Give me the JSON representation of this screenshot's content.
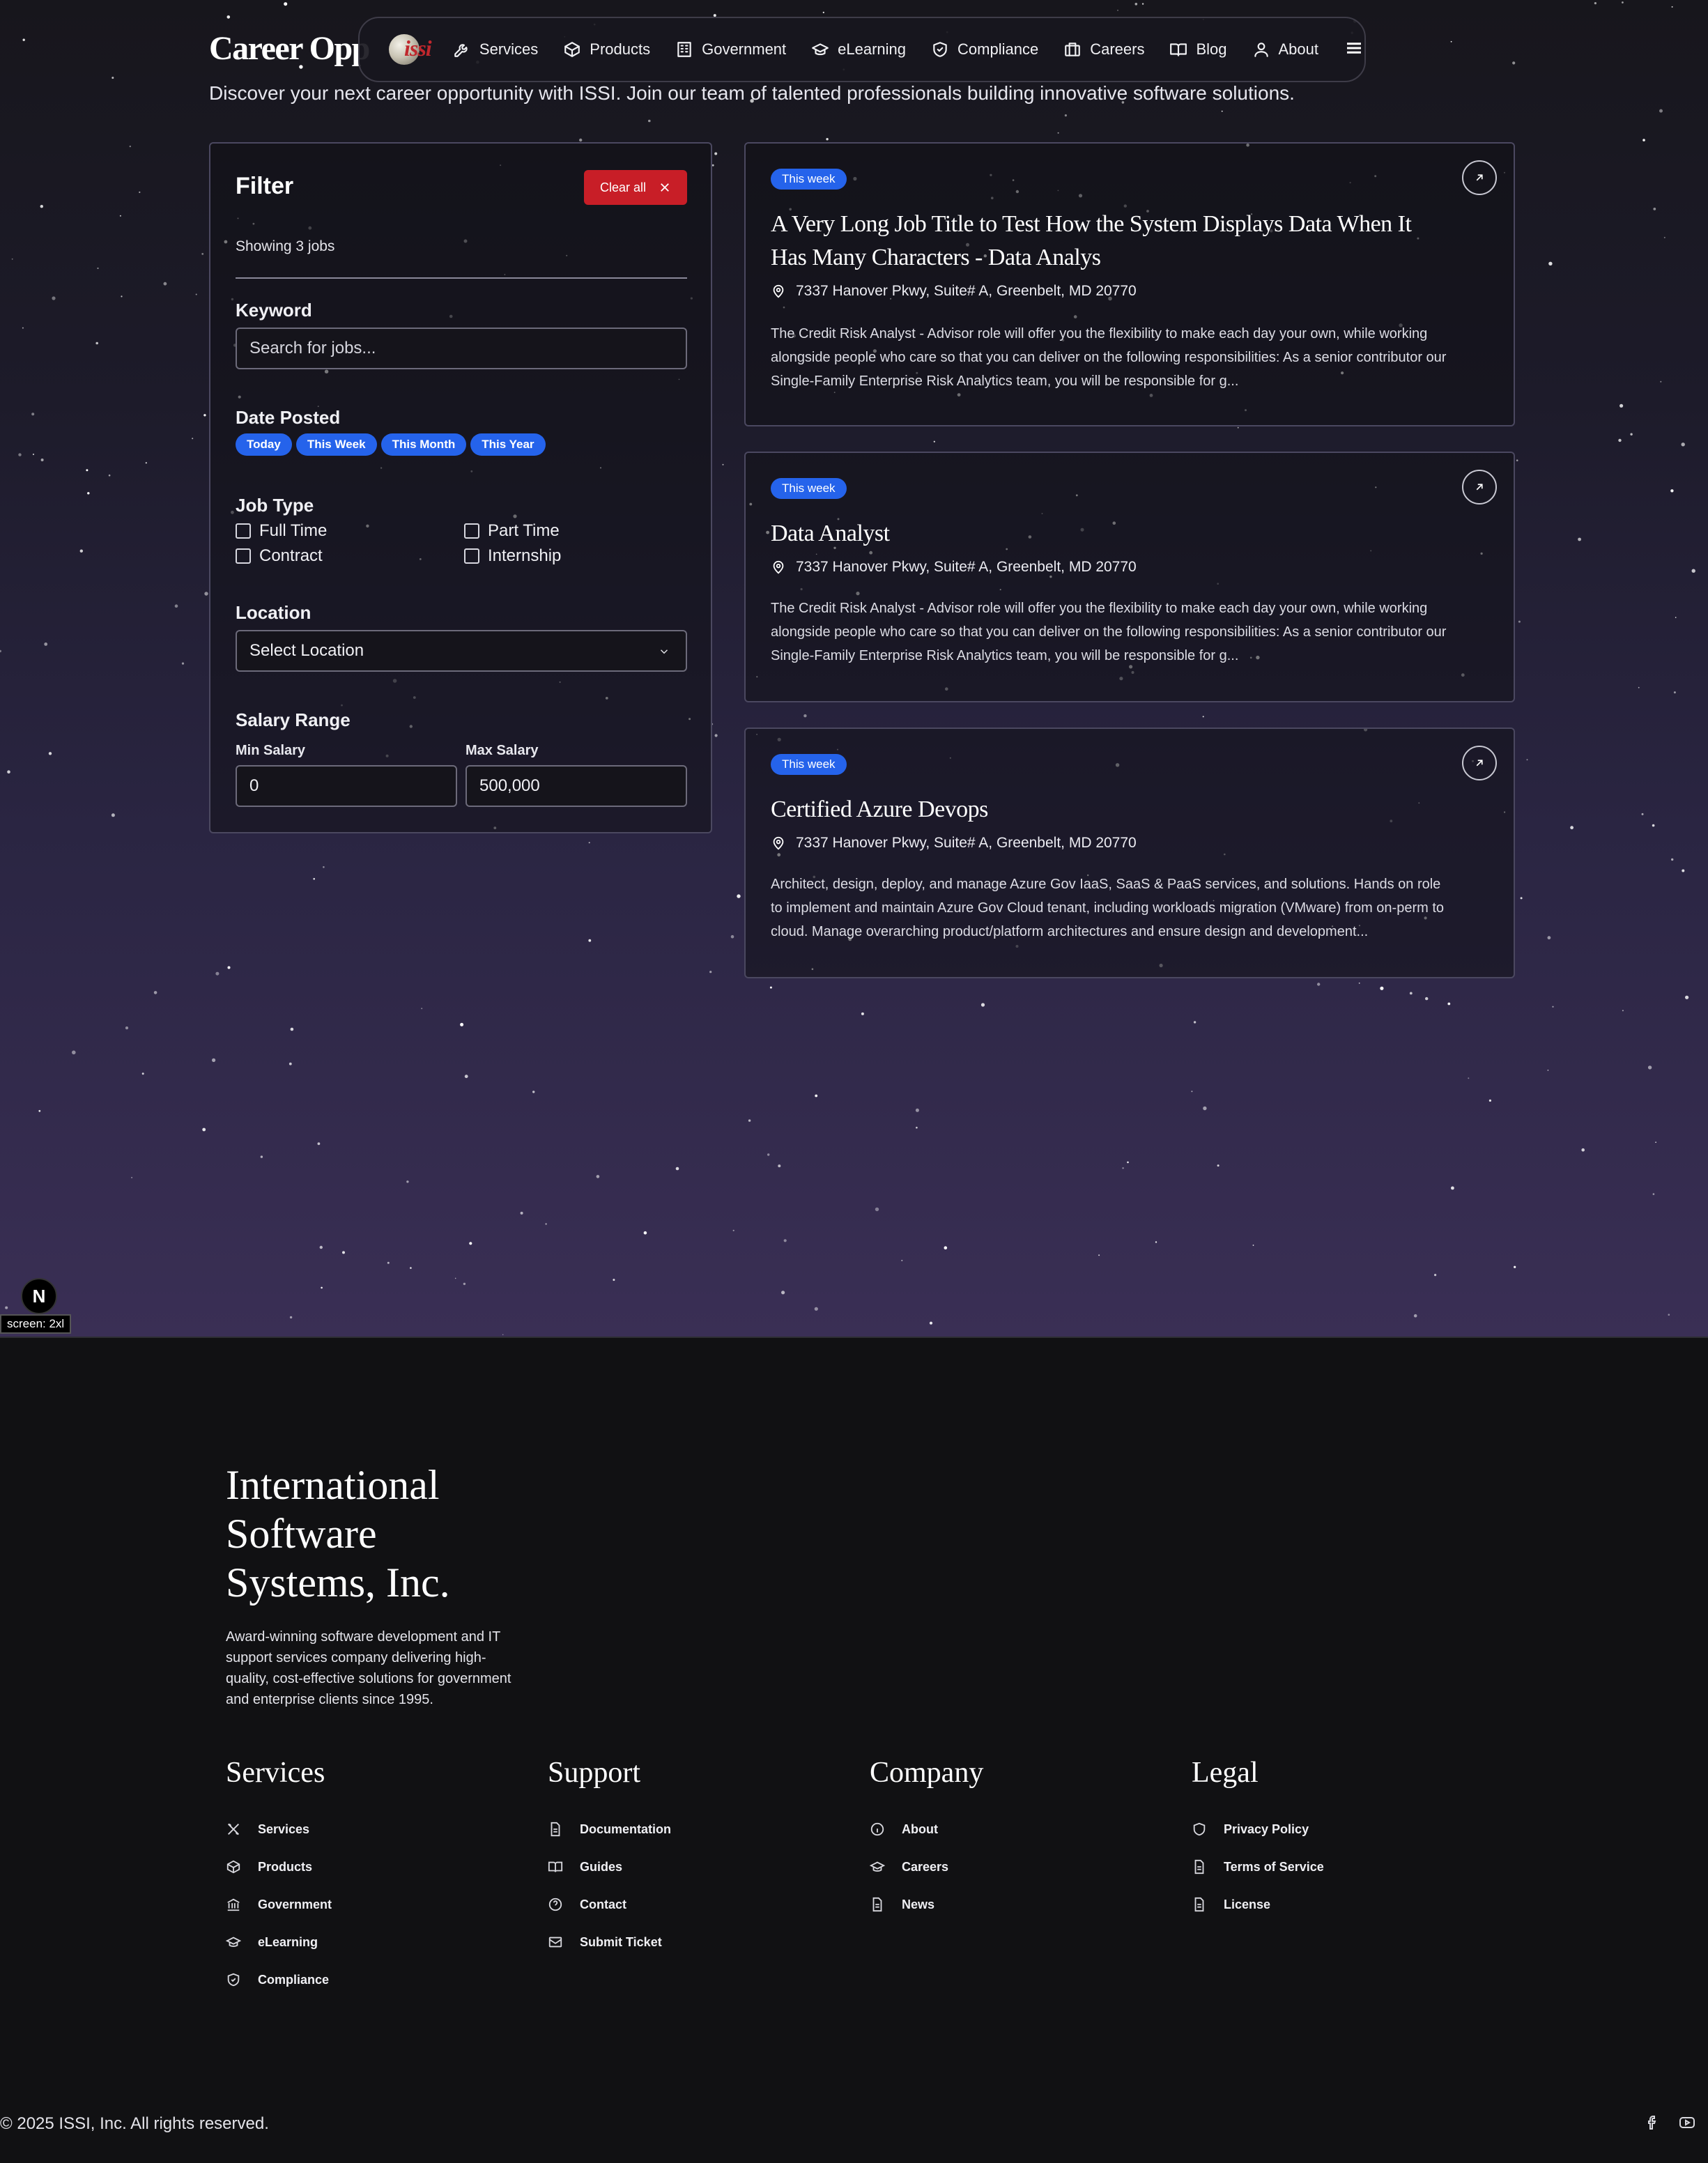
{
  "page": {
    "title": "Career Opportu",
    "subtitle": "Discover your next career opportunity with ISSI. Join our team of talented professionals building innovative software solutions."
  },
  "nav": {
    "logo_text": "issi",
    "items": [
      {
        "label": "Services",
        "icon": "wrench-icon"
      },
      {
        "label": "Products",
        "icon": "box-icon"
      },
      {
        "label": "Government",
        "icon": "building-icon"
      },
      {
        "label": "eLearning",
        "icon": "graduation-cap-icon"
      },
      {
        "label": "Compliance",
        "icon": "shield-icon"
      },
      {
        "label": "Careers",
        "icon": "briefcase-icon"
      },
      {
        "label": "Blog",
        "icon": "book-icon"
      },
      {
        "label": "About",
        "icon": "user-icon"
      }
    ],
    "menu_icon": "hamburger-icon"
  },
  "filter": {
    "title": "Filter",
    "clear_label": "Clear all",
    "showing": "Showing 3 jobs",
    "keyword_label": "Keyword",
    "keyword_placeholder": "Search for jobs...",
    "date_label": "Date Posted",
    "date_options": [
      "Today",
      "This Week",
      "This Month",
      "This Year"
    ],
    "jobtype_label": "Job Type",
    "jobtypes": [
      "Full Time",
      "Part Time",
      "Contract",
      "Internship"
    ],
    "location_label": "Location",
    "location_value": "Select Location",
    "salary_label": "Salary Range",
    "min_label": "Min Salary",
    "min_value": "0",
    "max_label": "Max Salary",
    "max_value": "500,000"
  },
  "jobs": [
    {
      "badge": "This week",
      "title": "A Very Long Job Title to Test How the System Displays Data When It Has Many Characters - Data Analys",
      "location": "7337 Hanover Pkwy, Suite# A, Greenbelt, MD 20770",
      "description": "The Credit Risk Analyst - Advisor role will offer you the flexibility to make each day your own, while working alongside people who care so that you can deliver on the following responsibilities: As a senior contributor our Single-Family Enterprise Risk Analytics team, you will be responsible for g..."
    },
    {
      "badge": "This week",
      "title": "Data Analyst",
      "location": "7337 Hanover Pkwy, Suite# A, Greenbelt, MD 20770",
      "description": "The Credit Risk Analyst - Advisor role will offer you the flexibility to make each day your own, while working alongside people who care so that you can deliver on the following responsibilities: As a senior contributor our Single-Family Enterprise Risk Analytics team, you will be responsible for g..."
    },
    {
      "badge": "This week",
      "title": "Certified Azure Devops",
      "location": "7337 Hanover Pkwy, Suite# A, Greenbelt, MD 20770",
      "description": "Architect, design, deploy, and manage Azure Gov IaaS, SaaS & PaaS services, and solutions. Hands on role to implement and maintain Azure Gov Cloud tenant, including workloads migration (VMware) from on-perm to cloud. Manage overarching product/platform architectures and ensure design and development..."
    }
  ],
  "dev": {
    "next_badge": "N",
    "screen_tag": "screen: 2xl"
  },
  "footer": {
    "company": "International Software Systems, Inc.",
    "blurb": "Award-winning software development and IT support services company delivering high-quality, cost-effective solutions for government and enterprise clients since 1995.",
    "columns": [
      {
        "heading": "Services",
        "links": [
          "Services",
          "Products",
          "Government",
          "eLearning",
          "Compliance"
        ]
      },
      {
        "heading": "Support",
        "links": [
          "Documentation",
          "Guides",
          "Contact",
          "Submit Ticket"
        ]
      },
      {
        "heading": "Company",
        "links": [
          "About",
          "Careers",
          "News"
        ]
      },
      {
        "heading": "Legal",
        "links": [
          "Privacy Policy",
          "Terms of Service",
          "License"
        ]
      }
    ],
    "copyright": "© 2025 ISSI, Inc. All rights reserved.",
    "socials": [
      "facebook-icon",
      "youtube-icon"
    ]
  },
  "colors": {
    "accent": "#2563eb",
    "danger": "#c81e27",
    "background": "#111113"
  }
}
